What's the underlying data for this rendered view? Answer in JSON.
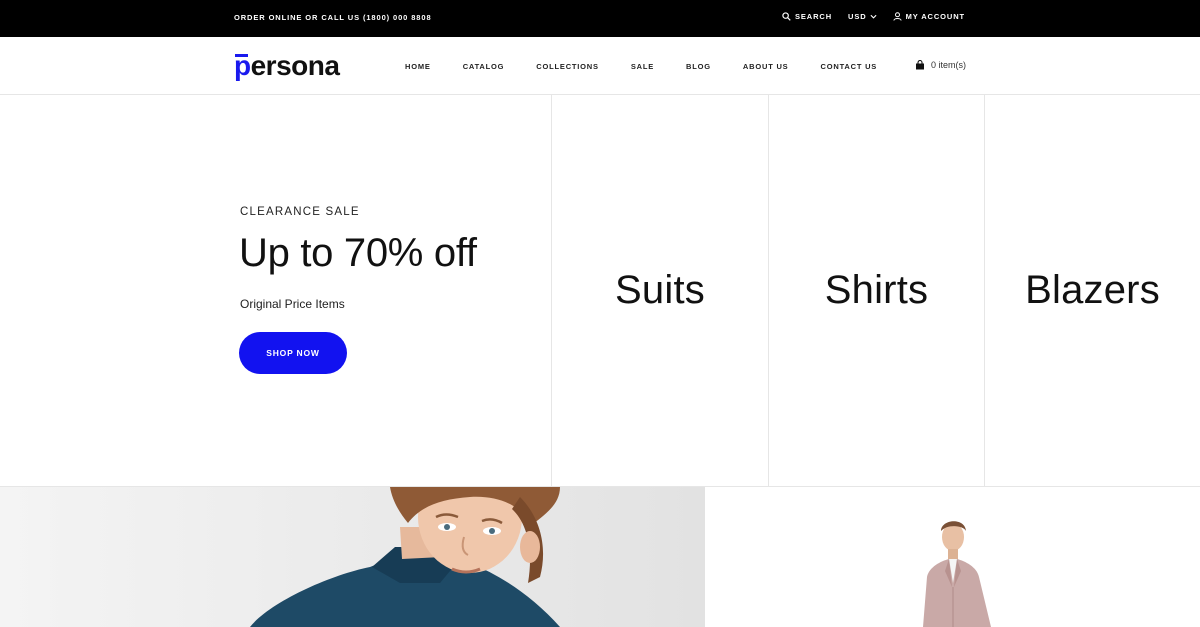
{
  "topbar": {
    "promo": "ORDER ONLINE OR CALL US (1800) 000 8808",
    "search": "SEARCH",
    "currency": "USD",
    "account": "MY ACCOUNT"
  },
  "header": {
    "logo_first": "p",
    "logo_rest": "ersona",
    "nav": [
      "HOME",
      "CATALOG",
      "COLLECTIONS",
      "SALE",
      "BLOG",
      "ABOUT US",
      "CONTACT US"
    ],
    "cart": "0 item(s)"
  },
  "hero": {
    "eyebrow": "CLEARANCE SALE",
    "headline": "Up to 70% off",
    "subtext": "Original Price Items",
    "button": "SHOP NOW",
    "categories": [
      "Suits",
      "Shirts",
      "Blazers"
    ]
  },
  "colors": {
    "accent": "#1212f0",
    "topbar_bg": "#000000",
    "sweater": "#1e4a66",
    "blazer": "#c9a9a7"
  }
}
